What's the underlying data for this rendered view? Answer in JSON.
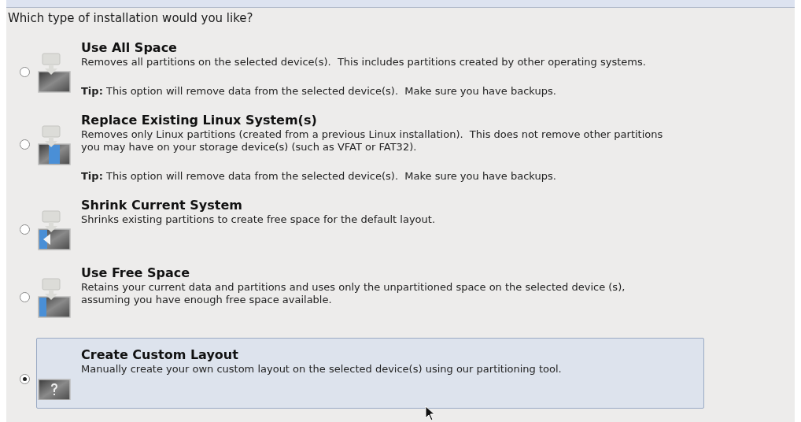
{
  "question": "Which type of installation would you like?",
  "options": [
    {
      "kind": "all",
      "title": "Use All Space",
      "description": "Removes all partitions on the selected device(s).  This includes partitions created by other operating systems.",
      "tip": "**Tip:** This option will remove data from the selected device(s).  Make sure you have backups.",
      "selected": false
    },
    {
      "kind": "replace",
      "title": "Replace Existing Linux System(s)",
      "description": "Removes only Linux partitions (created from a previous Linux installation).  This does not remove other partitions you may have on your storage device(s) (such as VFAT or FAT32).",
      "tip": "**Tip:** This option will remove data from the selected device(s).  Make sure you have backups.",
      "selected": false
    },
    {
      "kind": "shrink",
      "title": "Shrink Current System",
      "description": "Shrinks existing partitions to create free space for the default layout.",
      "selected": false
    },
    {
      "kind": "free",
      "title": "Use Free Space",
      "description": "Retains your current data and partitions and uses only the unpartitioned space on the selected device (s), assuming you have enough free space available.",
      "selected": false
    },
    {
      "kind": "custom",
      "title": "Create Custom Layout",
      "description": "Manually create your own custom layout on the selected device(s) using our partitioning tool.",
      "selected": true
    }
  ]
}
